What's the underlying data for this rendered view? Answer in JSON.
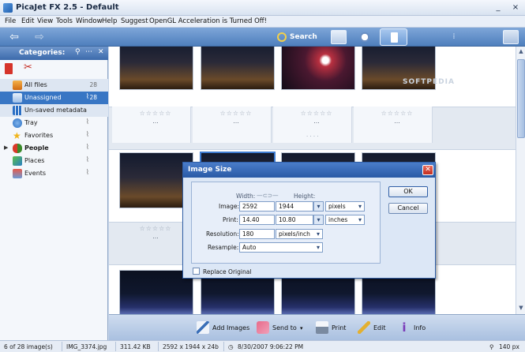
{
  "window": {
    "title": "PicaJet FX 2.5  -  Default",
    "minimize": "_",
    "close": "×"
  },
  "menu": [
    "File",
    "Edit",
    "View",
    "Tools",
    "Window",
    "Help",
    "Suggest",
    "OpenGL Acceleration is Turned Off!"
  ],
  "toolbar": {
    "back_icon": "back-arrow-icon",
    "forward_icon": "forward-arrow-icon",
    "search_label": "Search"
  },
  "categories": {
    "header": "Categories:",
    "items": [
      {
        "label": "All files",
        "count": "28",
        "icon": "all-files-icon",
        "clip": false
      },
      {
        "label": "Unassigned",
        "count": "28",
        "icon": "unassigned-icon",
        "clip": true
      },
      {
        "label": "Un-saved metadata",
        "count": "",
        "icon": "metadata-icon",
        "clip": false
      },
      {
        "label": "Tray",
        "count": "",
        "icon": "tray-icon",
        "clip": true
      },
      {
        "label": "Favorites",
        "count": "",
        "icon": "star-icon",
        "clip": true
      },
      {
        "label": "People",
        "count": "",
        "icon": "people-icon",
        "clip": true
      },
      {
        "label": "Places",
        "count": "",
        "icon": "places-icon",
        "clip": true
      },
      {
        "label": "Events",
        "count": "",
        "icon": "events-icon",
        "clip": true
      }
    ]
  },
  "thumbnails": {
    "rating": "☆☆☆☆☆",
    "more": "...",
    "watermark": "SOFTPEDIA",
    "separator": ". . . ."
  },
  "dialog": {
    "title": "Image Size",
    "width_label": "Width:",
    "height_label": "Height:",
    "image_label": "Image:",
    "image_width": "2592",
    "image_height": "1944",
    "image_unit": "pixels",
    "print_label": "Print:",
    "print_width": "14.40",
    "print_height": "10.80",
    "print_unit": "inches",
    "resolution_label": "Resolution:",
    "resolution_value": "180",
    "resolution_unit": "pixels/inch",
    "resample_label": "Resample:",
    "resample_value": "Auto",
    "replace_label": "Replace Original",
    "ok_label": "OK",
    "cancel_label": "Cancel"
  },
  "actions": {
    "add_images": "Add Images",
    "send_to": "Send to",
    "print": "Print",
    "edit": "Edit",
    "info": "Info"
  },
  "status": {
    "count": "6 of 28 image(s)",
    "filename": "IMG_3374.jpg",
    "size": "311.42 KB",
    "dimensions": "2592 x 1944 x 24b",
    "date": "8/30/2007 9:06:22 PM",
    "zoom": "140 px"
  }
}
